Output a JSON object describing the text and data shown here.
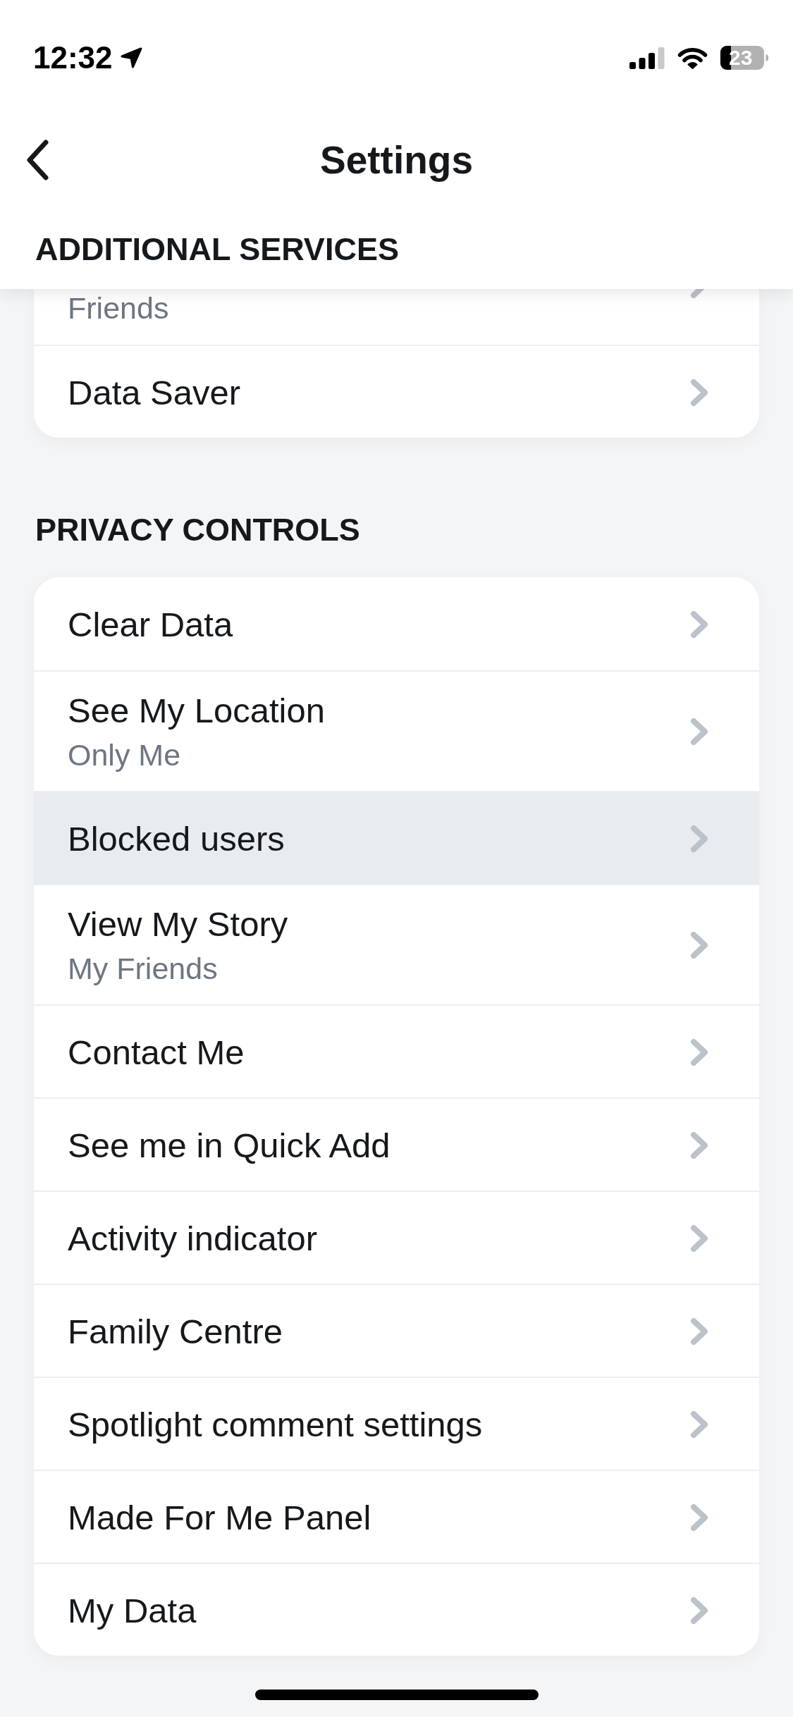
{
  "status_bar": {
    "time": "12:32",
    "battery": "23"
  },
  "nav_bar": {
    "title": "Settings"
  },
  "sections": [
    {
      "heading": "ADDITIONAL SERVICES",
      "pinned": true,
      "items": [
        {
          "subtitle": "Friends",
          "selected": false
        },
        {
          "title": "Data Saver",
          "selected": false
        }
      ]
    },
    {
      "heading": "PRIVACY CONTROLS",
      "pinned": false,
      "items": [
        {
          "title": "Clear Data",
          "selected": false
        },
        {
          "title": "See My Location",
          "subtitle": "Only Me",
          "selected": false
        },
        {
          "title": "Blocked users",
          "selected": true
        },
        {
          "title": "View My Story",
          "subtitle": "My Friends",
          "selected": false
        },
        {
          "title": "Contact Me",
          "selected": false
        },
        {
          "title": "See me in Quick Add",
          "selected": false
        },
        {
          "title": "Activity indicator",
          "selected": false
        },
        {
          "title": "Family Centre",
          "selected": false
        },
        {
          "title": "Spotlight comment settings",
          "selected": false
        },
        {
          "title": "Made For Me Panel",
          "selected": false
        },
        {
          "title": "My Data",
          "selected": false
        }
      ]
    }
  ]
}
